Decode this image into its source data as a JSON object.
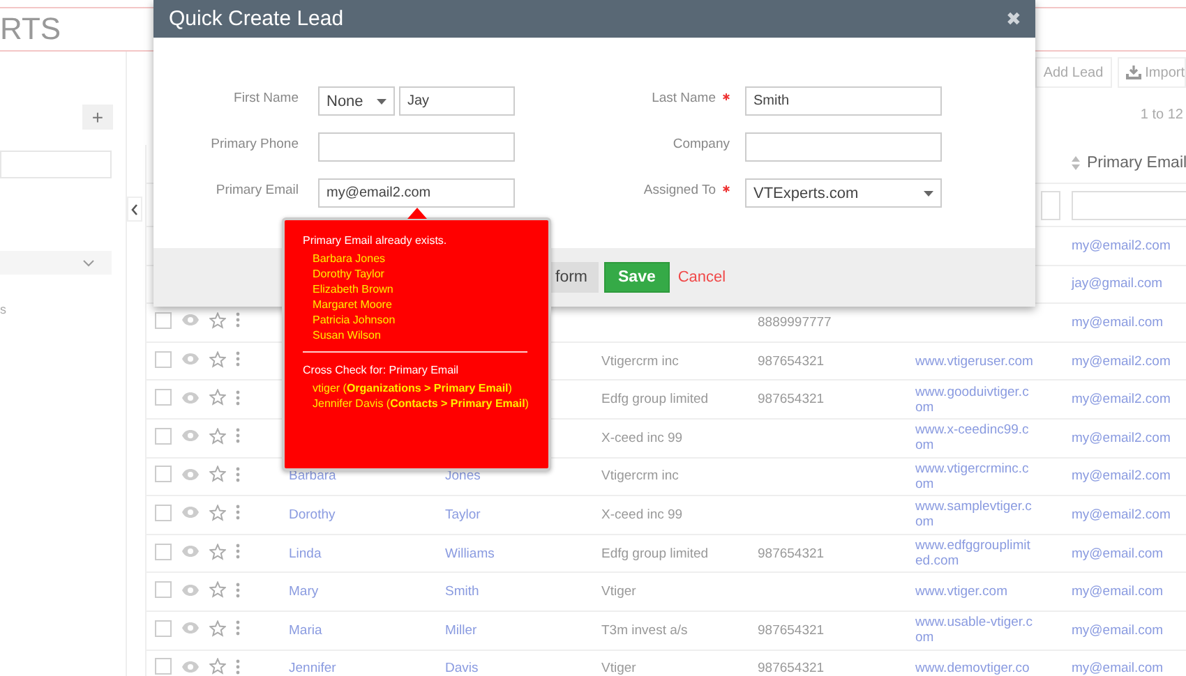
{
  "header": {
    "logo": "RTS"
  },
  "toolbar": {
    "buttons": [
      "Add Lead",
      "Import"
    ],
    "pagination": "1 to 12"
  },
  "sidebar": {
    "add_button": "+",
    "fragment": "s"
  },
  "table": {
    "email_heading": "Primary Email",
    "rows": [
      {
        "email": "my@email2.com"
      },
      {
        "email": "jay@gmail.com"
      },
      {
        "checked": false,
        "phone": "8889997777",
        "email": "my@email.com"
      },
      {
        "checked": false,
        "company": "Vtigercrm inc",
        "phone": "987654321",
        "website": "www.vtigeruser.com",
        "email": "my@email2.com"
      },
      {
        "checked": false,
        "company": "Edfg group limited",
        "phone": "987654321",
        "website": "www.gooduivtiger.com",
        "email": "my@email2.com"
      },
      {
        "checked": false,
        "company": "X-ceed inc 99",
        "website": "www.x-ceedinc99.com",
        "email": "my@email2.com"
      },
      {
        "checked": false,
        "first_name": "Barbara",
        "last_name": "Jones",
        "company": "Vtigercrm inc",
        "website": "www.vtigercrminc.com",
        "email": "my@email2.com"
      },
      {
        "checked": false,
        "first_name": "Dorothy",
        "last_name": "Taylor",
        "company": "X-ceed inc 99",
        "website": "www.samplevtiger.com",
        "email": "my@email2.com"
      },
      {
        "checked": false,
        "first_name": "Linda",
        "last_name": "Williams",
        "company": "Edfg group limited",
        "phone": "987654321",
        "website": "www.edfggrouplimited.com",
        "email": "my@email.com"
      },
      {
        "checked": false,
        "first_name": "Mary",
        "last_name": "Smith",
        "company": "Vtiger",
        "website": "www.vtiger.com",
        "email": "my@email.com"
      },
      {
        "checked": false,
        "first_name": "Maria",
        "last_name": "Miller",
        "company": "T3m invest a/s",
        "phone": "987654321",
        "website": "www.usable-vtiger.com",
        "email": "my@email.com"
      },
      {
        "checked": false,
        "first_name": "Jennifer",
        "last_name": "Davis",
        "company": "Vtiger",
        "phone": "987654321",
        "website": "www.demovtiger.co",
        "email": "my@email.com"
      }
    ]
  },
  "modal": {
    "title": "Quick Create Lead",
    "close": "✖",
    "left_fields": [
      {
        "label": "First Name",
        "kind": "name",
        "salutation": "None",
        "value": "Jay"
      },
      {
        "label": "Primary Phone",
        "kind": "text"
      },
      {
        "label": "Primary Email",
        "kind": "text",
        "value": "my@email2.com"
      }
    ],
    "right_fields": [
      {
        "label": "Last Name",
        "required": true,
        "kind": "text",
        "value": "Smith"
      },
      {
        "label": "Company",
        "required": false,
        "kind": "text"
      },
      {
        "label": "Assigned To",
        "required": true,
        "kind": "select",
        "value": "VTExperts.com"
      }
    ],
    "full_form_button": "form",
    "save_button": "Save",
    "cancel_link": "Cancel"
  },
  "popup": {
    "heading": "Primary Email already exists.",
    "matches": [
      "Barbara Jones",
      "Dorothy Taylor",
      "Elizabeth Brown",
      "Margaret Moore",
      "Patricia Johnson",
      "Susan Wilson"
    ],
    "cross_heading": "Cross Check for: Primary Email",
    "cross_matches": [
      "vtiger (**Organizations > Primary Email**)",
      "Jennifer Davis (**Contacts > Primary Email**)"
    ]
  }
}
